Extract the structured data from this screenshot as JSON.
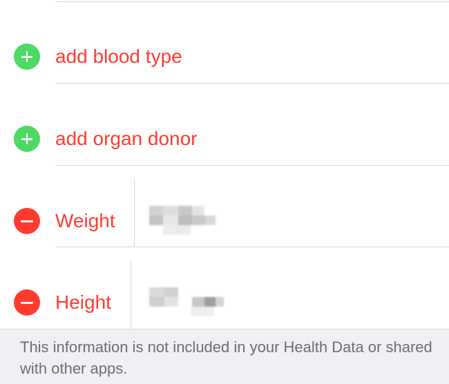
{
  "medical_id_edit": {
    "rows": [
      {
        "label": "add blood type",
        "action": "add",
        "icon": "plus-circle-icon"
      },
      {
        "label": "add organ donor",
        "action": "add",
        "icon": "plus-circle-icon"
      },
      {
        "label": "Weight",
        "action": "remove",
        "icon": "minus-circle-icon"
      },
      {
        "label": "Height",
        "action": "remove",
        "icon": "minus-circle-icon"
      }
    ],
    "footer_note": "This information is not included in your Health Data or shared with other apps."
  },
  "colors": {
    "add": "#4cd964",
    "remove": "#ff3b30",
    "label": "#ff3b30",
    "footer_background": "#efeff4",
    "footer_text": "#6d6d72"
  }
}
